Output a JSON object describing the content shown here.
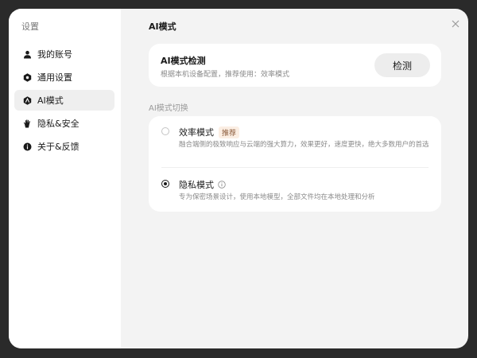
{
  "sidebar": {
    "title": "设置",
    "items": [
      {
        "label": "我的账号",
        "icon": "user-icon",
        "active": false
      },
      {
        "label": "通用设置",
        "icon": "hexagon-settings-icon",
        "active": false
      },
      {
        "label": "AI模式",
        "icon": "ai-shield-icon",
        "active": true
      },
      {
        "label": "隐私&安全",
        "icon": "hand-icon",
        "active": false
      },
      {
        "label": "关于&反馈",
        "icon": "info-icon",
        "active": false
      }
    ]
  },
  "main": {
    "title": "AI模式",
    "detect": {
      "title": "AI模式检测",
      "description": "根据本机设备配置，推荐使用：效率模式",
      "button_label": "检测"
    },
    "switch_section_label": "AI模式切换",
    "modes": [
      {
        "title": "效率模式",
        "badge": "推荐",
        "description": "融合端侧的极致响应与云端的强大算力，效果更好，速度更快，绝大多数用户的首选",
        "selected": false
      },
      {
        "title": "隐私模式",
        "badge": "",
        "description": "专为保密场景设计，使用本地模型，全部文件均在本地处理和分析",
        "selected": true
      }
    ]
  },
  "colors": {
    "background": "#f3f3f3",
    "card": "#ffffff",
    "active_item": "#efefef",
    "badge_bg": "#fbeee3",
    "badge_text": "#8a5a3a"
  }
}
